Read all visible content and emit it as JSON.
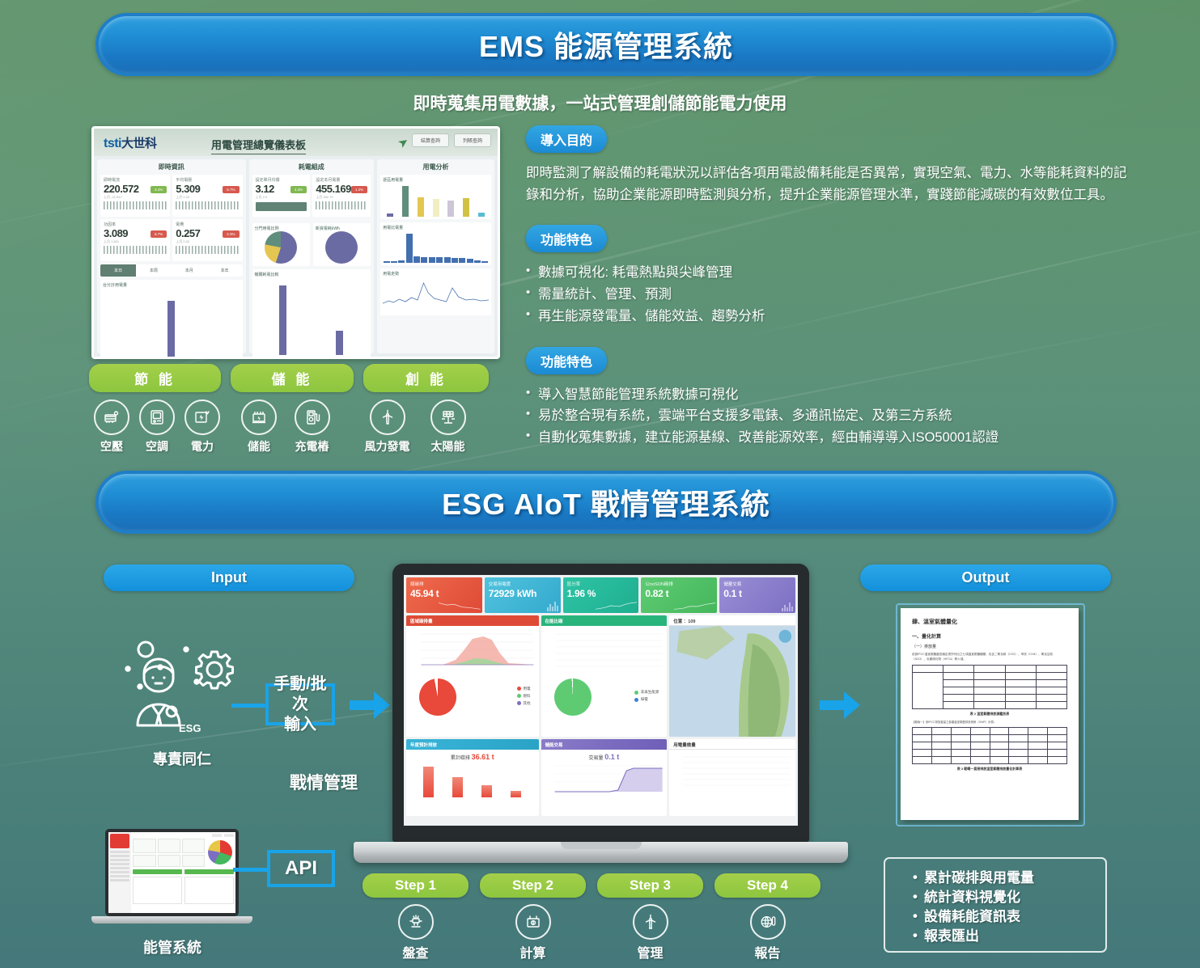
{
  "ems": {
    "header": "EMS 能源管理系統",
    "subtitle": "即時蒐集用電數據，一站式管理創儲節能電力使用",
    "purpose_tag": "導入目的",
    "purpose_text": "即時監測了解設備的耗電狀況以評估各項用電設備耗能是否異常，實現空氣、電力、水等能耗資料的記錄和分析，協助企業能源即時監測與分析，提升企業能源管理水準，實踐節能減碳的有效數位工具。",
    "features_tag_1": "功能特色",
    "features_1": [
      "數據可視化: 耗電熱點與尖峰管理",
      "需量統計、管理、預測",
      "再生能源發電量、儲能效益、趨勢分析"
    ],
    "features_tag_2": "功能特色",
    "features_2": [
      "導入智慧節能管理系統數據可視化",
      "易於整合現有系統，雲端平台支援多電錶、多通訊協定、及第三方系統",
      "自動化蒐集數據，建立能源基線、改善能源效率，經由輔導導入ISO50001認證"
    ],
    "dashboard": {
      "logo": "tsti",
      "logo_cn": "大世科",
      "title": "用電管理總覽儀表板",
      "btn1": "結算查詢",
      "btn2": "列賬查詢",
      "col1_title": "即時資訊",
      "col2_title": "耗電組成",
      "col3_title": "用電分析",
      "kpis": [
        {
          "label": "即時電流",
          "value": "220.572",
          "sub": "上月 -22.547",
          "chip": "3.4%",
          "chip_type": "g"
        },
        {
          "label": "平均電壓",
          "value": "5.309",
          "sub": "上月 0.23",
          "chip": "5.7%",
          "chip_type": "r"
        },
        {
          "label": "功因率",
          "value": "3.089",
          "sub": "上月 1.601",
          "chip": "6.7%",
          "chip_type": "r"
        },
        {
          "label": "電費",
          "value": "0.257",
          "sub": "上月 0.02",
          "chip": "2.3%",
          "chip_type": "r"
        }
      ],
      "kpis2": [
        {
          "label": "設定單月均價",
          "value": "3.12",
          "sub": "上月 2.9",
          "chip": "4.3%",
          "chip_type": "g"
        },
        {
          "label": "設定本月電量",
          "value": "455.169",
          "sub": "上月 382.79",
          "chip": "1.2%",
          "chip_type": "r"
        }
      ],
      "tabs": [
        "本日",
        "本周",
        "本月",
        "本年"
      ],
      "chart_titles": [
        "台分計用電量",
        "分門用電比例",
        "新資電耗kWh",
        "機關耗電比較",
        "逐區用電量",
        "用電比電量",
        "用電走勢"
      ]
    },
    "categories": [
      {
        "label": "節 能",
        "items": [
          {
            "icon": "air-compressor-icon",
            "label": "空壓"
          },
          {
            "icon": "air-conditioner-icon",
            "label": "空調"
          },
          {
            "icon": "electricity-icon",
            "label": "電力"
          }
        ]
      },
      {
        "label": "儲 能",
        "items": [
          {
            "icon": "battery-storage-icon",
            "label": "儲能"
          },
          {
            "icon": "charging-pile-icon",
            "label": "充電樁"
          }
        ]
      },
      {
        "label": "創 能",
        "items": [
          {
            "icon": "wind-turbine-icon",
            "label": "風力發電"
          },
          {
            "icon": "solar-panel-icon",
            "label": "太陽能"
          }
        ]
      }
    ]
  },
  "esg": {
    "header": "ESG AIoT 戰情管理系統",
    "input_label": "Input",
    "output_label": "Output",
    "person_caption": "專責同仁",
    "person_badge": "ESG",
    "manual_box": "手動/批次\n輸入",
    "manual_box_line1": "手動/批次",
    "manual_box_line2": "輸入",
    "center_caption": "戰情管理",
    "api_box": "API",
    "ems_caption": "能管系統",
    "steps": [
      {
        "pill": "Step 1",
        "icon": "inventory-icon",
        "label": "盤查"
      },
      {
        "pill": "Step 2",
        "icon": "battery-icon",
        "label": "計算"
      },
      {
        "pill": "Step 3",
        "icon": "wind-turbine-icon",
        "label": "管理"
      },
      {
        "pill": "Step 4",
        "icon": "globe-report-icon",
        "label": "報告"
      }
    ],
    "outputs": [
      "累計碳排與用電量",
      "統計資料視覺化",
      "設備耗能資訊表",
      "報表匯出"
    ],
    "laptop_kpis": [
      {
        "label": "總碳排",
        "value": "45.94 t",
        "color": "#e4573f"
      },
      {
        "label": "交易用電度",
        "value": "72929 kWh",
        "color": "#3fb6d8"
      },
      {
        "label": "區分率",
        "value": "1.96 %",
        "color": "#25b79a"
      },
      {
        "label": "公noSON碳排",
        "value": "0.82 t",
        "color": "#4ec06a"
      },
      {
        "label": "儲量交易",
        "value": "0.1 t",
        "color": "#8a7fc9"
      }
    ],
    "laptop_panels": [
      {
        "title": "區域碳排量",
        "color": "#e4573f"
      },
      {
        "title": "在能比碳",
        "color": "#29b47c"
      },
      {
        "title": "位置 ：109",
        "color": "#ffffff"
      },
      {
        "title": "年度預計排放",
        "color": "#3fb6d8"
      },
      {
        "title": "儲能交易",
        "color": "#7b6cc0"
      },
      {
        "title": "用電量檢量",
        "color": "#ffffff"
      }
    ],
    "laptop_values": [
      {
        "label": "累計碳排",
        "value": "36.61 t"
      },
      {
        "label": "交易量",
        "value": "0.1 t"
      }
    ],
    "doc": {
      "heading": "肆、溫室氣體量化",
      "sub1": "一、量化計算",
      "sub2": "（一）排放量",
      "caption1": "表 2 溫室氣體排放源鑑別表",
      "caption2": "表 3 範疇一直接排放溫室氣體排放量化計算表"
    }
  },
  "colors": {
    "blue": "#1b8ad3",
    "blue_light": "#2ba8e8",
    "green": "#8dc63f",
    "arrow": "#19a3e8"
  }
}
